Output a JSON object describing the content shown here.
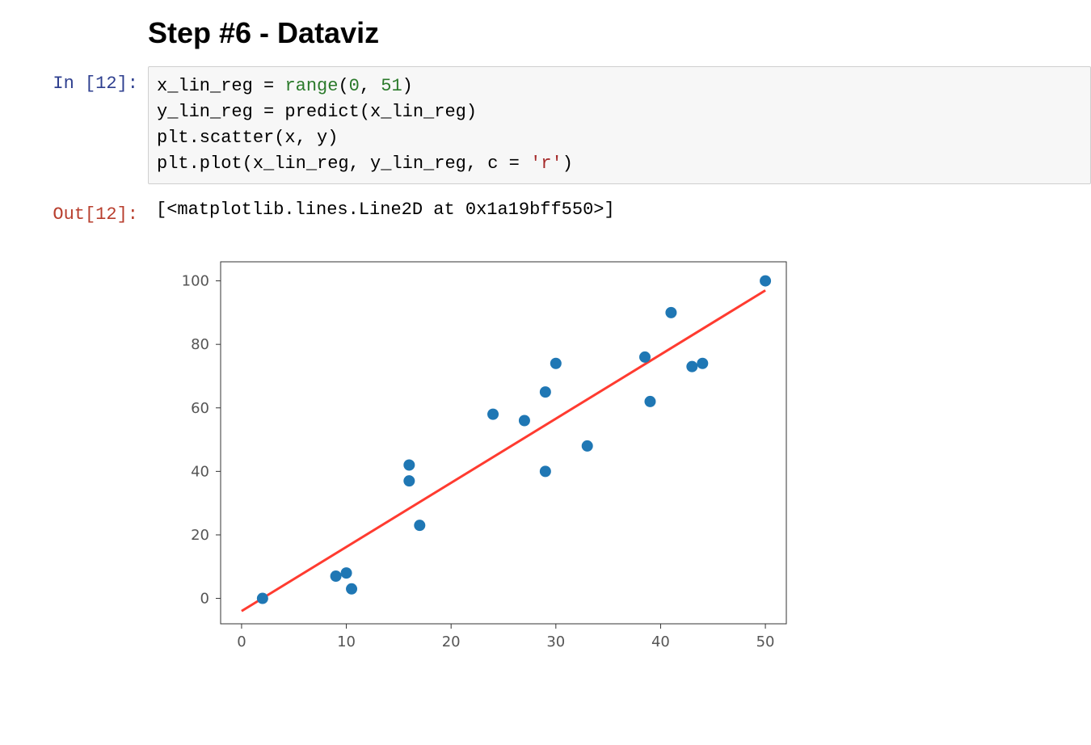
{
  "heading": "Step #6 - Dataviz",
  "in_prompt": "In [12]:",
  "out_prompt": "Out[12]:",
  "code": {
    "line1_a": "x_lin_reg ",
    "line1_eq": "= ",
    "line1_fn": "range",
    "line1_paren_open": "(",
    "line1_arg0": "0",
    "line1_comma": ", ",
    "line1_arg1": "51",
    "line1_paren_close": ")",
    "line2": "y_lin_reg = predict(x_lin_reg)",
    "line3": "plt.scatter(x, y)",
    "line4_a": "plt.plot(x_lin_reg, y_lin_reg, c = ",
    "line4_str": "'r'",
    "line4_b": ")"
  },
  "output_text": "[<matplotlib.lines.Line2D at 0x1a19bff550>]",
  "chart_data": {
    "type": "scatter",
    "xlim": [
      -2,
      52
    ],
    "ylim": [
      -8,
      106
    ],
    "x_ticks": [
      0,
      10,
      20,
      30,
      40,
      50
    ],
    "y_ticks": [
      0,
      20,
      40,
      60,
      80,
      100
    ],
    "scatter": {
      "color": "#1f77b4",
      "points": [
        {
          "x": 2,
          "y": 0
        },
        {
          "x": 9,
          "y": 7
        },
        {
          "x": 10,
          "y": 8
        },
        {
          "x": 10.5,
          "y": 3
        },
        {
          "x": 16,
          "y": 42
        },
        {
          "x": 16,
          "y": 37
        },
        {
          "x": 17,
          "y": 23
        },
        {
          "x": 24,
          "y": 58
        },
        {
          "x": 27,
          "y": 56
        },
        {
          "x": 29,
          "y": 65
        },
        {
          "x": 29,
          "y": 40
        },
        {
          "x": 30,
          "y": 74
        },
        {
          "x": 33,
          "y": 48
        },
        {
          "x": 38.5,
          "y": 76
        },
        {
          "x": 39,
          "y": 62
        },
        {
          "x": 41,
          "y": 90
        },
        {
          "x": 43,
          "y": 73
        },
        {
          "x": 44,
          "y": 74
        },
        {
          "x": 50,
          "y": 100
        }
      ]
    },
    "line": {
      "color": "#ff3b30",
      "x0": 0,
      "y0": -4,
      "x1": 50,
      "y1": 97
    }
  }
}
